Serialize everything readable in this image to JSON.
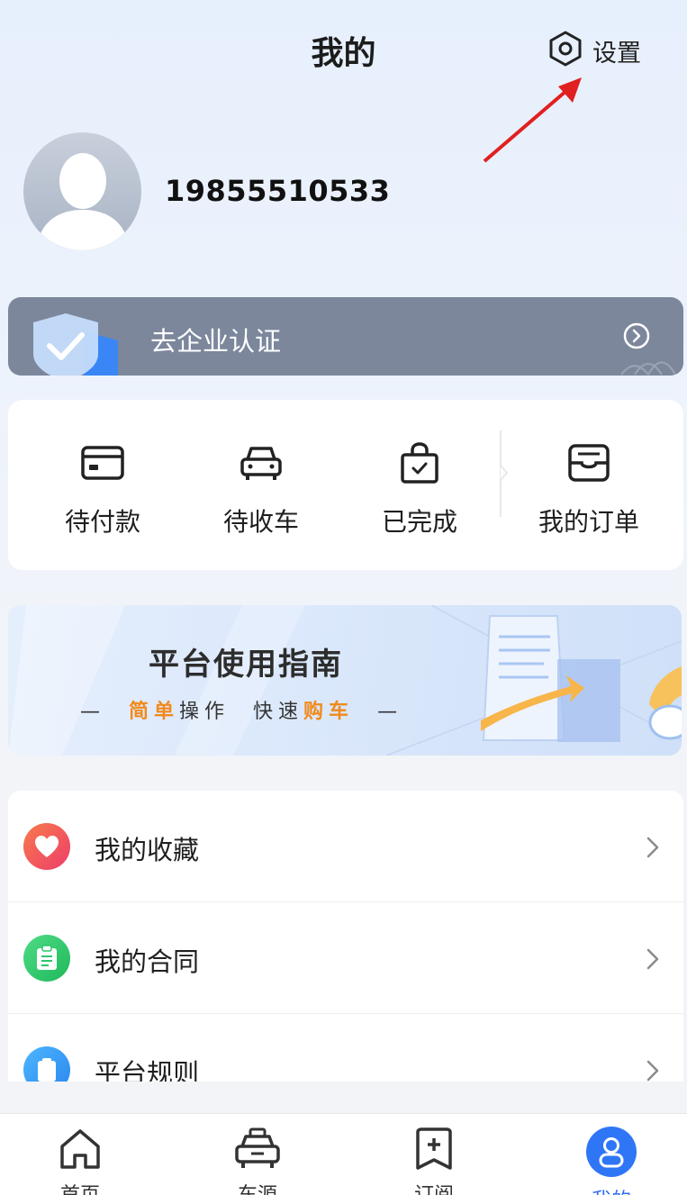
{
  "header": {
    "title": "我的",
    "settings_label": "设置"
  },
  "profile": {
    "phone": "19855510533"
  },
  "certification": {
    "label": "去企业认证"
  },
  "orders": [
    {
      "label": "待付款",
      "icon": "card-icon"
    },
    {
      "label": "待收车",
      "icon": "car-icon"
    },
    {
      "label": "已完成",
      "icon": "bag-check-icon"
    },
    {
      "label": "我的订单",
      "icon": "order-box-icon"
    }
  ],
  "guide": {
    "title": "平台使用指南",
    "sub_dash_left": "—",
    "sub_hl1": "简单",
    "sub_plain1": "操作",
    "sub_plain2": "快速",
    "sub_hl2": "购车",
    "sub_dash_right": "—"
  },
  "menu": [
    {
      "label": "我的收藏",
      "icon": "heart-icon",
      "color": "#f0504f"
    },
    {
      "label": "我的合同",
      "icon": "contract-icon",
      "color": "#2ec76b"
    },
    {
      "label": "平台规则",
      "icon": "rules-icon",
      "color": "#2f9bf2"
    }
  ],
  "tabs": [
    {
      "label": "首页",
      "icon": "home-icon"
    },
    {
      "label": "车源",
      "icon": "car-source-icon"
    },
    {
      "label": "订阅",
      "icon": "subscribe-icon"
    },
    {
      "label": "我的",
      "icon": "profile-icon",
      "active": true
    }
  ],
  "colors": {
    "accent": "#2f76f6",
    "highlight": "#f08a1c",
    "cert_bg": "#7c879c",
    "annotation": "#e02020"
  }
}
